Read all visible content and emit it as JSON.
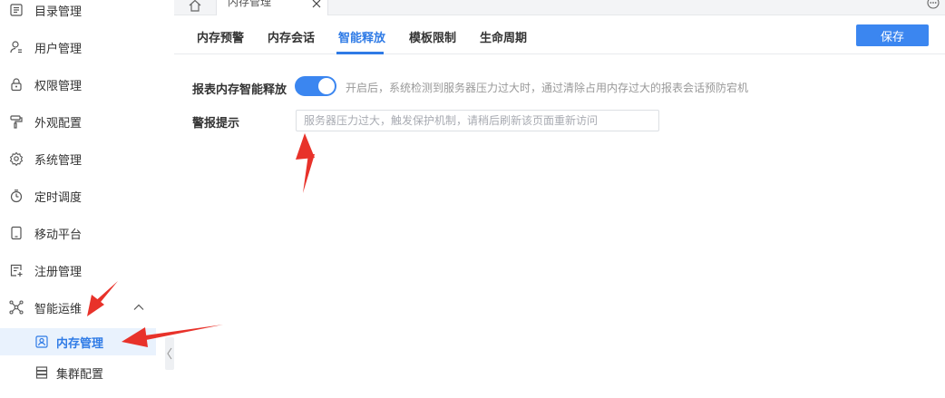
{
  "sidebar": {
    "items": [
      {
        "label": "目录管理",
        "icon": "catalog-icon"
      },
      {
        "label": "用户管理",
        "icon": "user-icon"
      },
      {
        "label": "权限管理",
        "icon": "lock-icon"
      },
      {
        "label": "外观配置",
        "icon": "paint-roller-icon"
      },
      {
        "label": "系统管理",
        "icon": "gear-icon"
      },
      {
        "label": "定时调度",
        "icon": "stopwatch-icon"
      },
      {
        "label": "移动平台",
        "icon": "tablet-icon"
      },
      {
        "label": "注册管理",
        "icon": "register-icon"
      },
      {
        "label": "智能运维",
        "icon": "network-icon",
        "expanded": true
      }
    ],
    "sub_items": [
      {
        "label": "内存管理",
        "icon": "memory-icon",
        "active": true
      },
      {
        "label": "集群配置",
        "icon": "server-icon"
      }
    ]
  },
  "tabbar": {
    "home_icon": "home-icon",
    "page_tab_label": "内存管理",
    "close_icon": "close-icon",
    "more_icon": "more-icon"
  },
  "subtabs": {
    "items": [
      "内存预警",
      "内存会话",
      "智能释放",
      "模板限制",
      "生命周期"
    ],
    "active_index": 2
  },
  "toolbar": {
    "save_label": "保存"
  },
  "form": {
    "smart_release_label": "报表内存智能释放",
    "smart_release_enabled": true,
    "smart_release_hint": "开启后，系统检测到服务器压力过大时，通过清除占用内存过大的报表会话预防宕机",
    "alert_label": "警报提示",
    "alert_placeholder": "服务器压力过大，触发保护机制，请稍后刷新该页面重新访问",
    "alert_value": ""
  },
  "colors": {
    "accent": "#3b86f0",
    "active_bg": "#e9f2fd",
    "annotation": "#e8322a"
  }
}
